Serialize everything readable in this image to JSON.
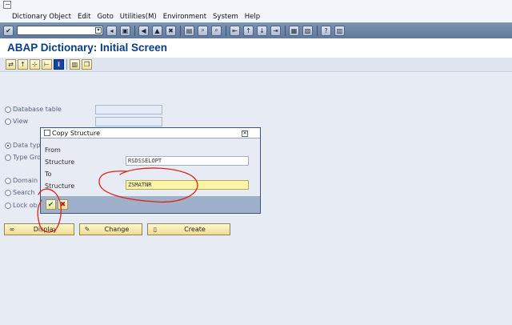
{
  "menubar": {
    "items": [
      "Dictionary Object",
      "Edit",
      "Goto",
      "Utilities(M)",
      "Environment",
      "System",
      "Help"
    ]
  },
  "toolbar": {
    "command_value": "",
    "icons": [
      "enter-icon",
      "save-icon",
      "back-icon",
      "exit-icon",
      "cancel-icon",
      "print-icon",
      "find-icon",
      "find-next-icon",
      "first-page-icon",
      "prev-page-icon",
      "next-page-icon",
      "last-page-icon",
      "create-session-icon",
      "shortcut-icon",
      "help-icon",
      "customize-layout-icon"
    ]
  },
  "screen": {
    "title": "ABAP Dictionary: Initial Screen"
  },
  "object_types": [
    {
      "label": "Database table",
      "checked": false
    },
    {
      "label": "View",
      "checked": false
    },
    {
      "label": "Data type",
      "checked": true
    },
    {
      "label": "Type Gro",
      "checked": false
    },
    {
      "label": "Domain",
      "checked": false
    },
    {
      "label": "Search",
      "checked": false
    },
    {
      "label": "Lock ob",
      "checked": false
    }
  ],
  "dialog": {
    "title": "Copy Structure",
    "from_label": "From",
    "from_structure_label": "Structure",
    "from_structure_value": "RSDSSELOPT",
    "to_label": "To",
    "to_structure_label": "Structure",
    "to_structure_value": "ZSMATNR"
  },
  "buttons": {
    "display": "Display",
    "change": "Change",
    "create": "Create"
  },
  "colors": {
    "accent_title": "#0b3d86",
    "toolbar": "#6d85a6",
    "active_field": "#fdf5a6",
    "annotation": "#e0201e"
  }
}
